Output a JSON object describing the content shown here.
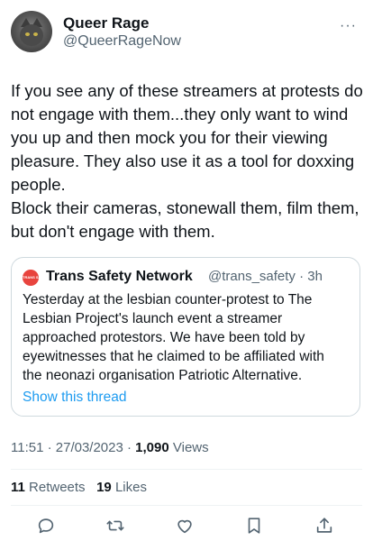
{
  "author": {
    "display_name": "Queer Rage",
    "handle": "@QueerRageNow"
  },
  "more_label": "···",
  "tweet": {
    "text": "If you see any of these streamers at protests do not engage with them...they only want to wind you up and then mock you for their viewing pleasure. They also use it as a tool for doxxing people.\nBlock their cameras, stonewall them, film them, but don't engage with them."
  },
  "quote": {
    "avatar_text": "TRANS SAFETY",
    "name": "Trans Safety Network",
    "meta": "@trans_safety · 3h",
    "text": "Yesterday at the lesbian counter-protest to The Lesbian Project's launch event a streamer approached protestors. We have been told by eyewitnesses that he claimed to be affiliated with the neonazi organisation Patriotic Alternative.",
    "show_thread": "Show this thread"
  },
  "meta": {
    "time_date": "11:51 · 27/03/2023 · ",
    "views_count": "1,090",
    "views_label": " Views"
  },
  "stats": {
    "retweets_count": "11",
    "retweets_label": "Retweets",
    "likes_count": "19",
    "likes_label": "Likes"
  },
  "actions": [
    "reply-icon",
    "retweet-icon",
    "like-icon",
    "bookmark-icon",
    "share-icon"
  ],
  "colors": {
    "text": "#0f1419",
    "muted": "#536471",
    "link": "#1d9bf0",
    "border": "#cfd9de"
  }
}
